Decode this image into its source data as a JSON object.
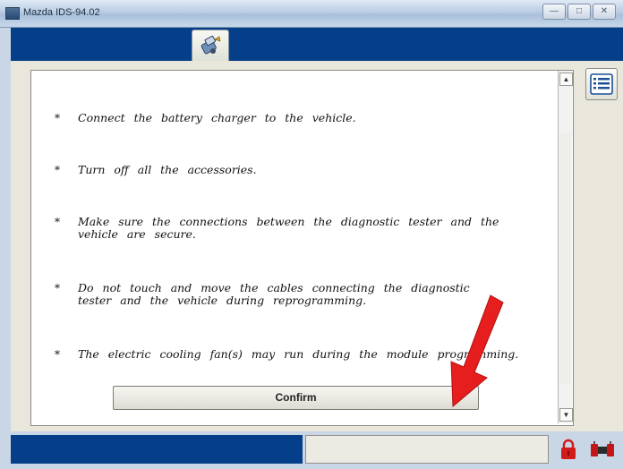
{
  "window": {
    "title": "Mazda IDS-94.02",
    "buttons": {
      "minimize": "—",
      "maximize": "□",
      "close": "✕"
    }
  },
  "instructions": {
    "items": [
      "Connect the battery charger to the vehicle.",
      "Turn off all the accessories.",
      "Make sure the connections between the diagnostic tester and the vehicle are secure.",
      "Do not touch and move the cables connecting the diagnostic tester and the vehicle during reprogramming.",
      "The electric cooling fan(s) may run during the module programming."
    ],
    "bullet": "*"
  },
  "actions": {
    "confirm_label": "Confirm"
  },
  "scrollbar": {
    "up": "▲",
    "down": "▼"
  },
  "icons": {
    "toolbar": "vehicle-tool-icon",
    "list": "list-icon",
    "lock": "lock-icon",
    "connection": "connection-icon",
    "annotation": "red-arrow"
  },
  "colors": {
    "header_blue": "#063f89",
    "arrow_red": "#e61e1e",
    "panel_bg": "#ffffff",
    "body_bg": "#e9e6dc",
    "lock_red": "#d21a1a"
  }
}
